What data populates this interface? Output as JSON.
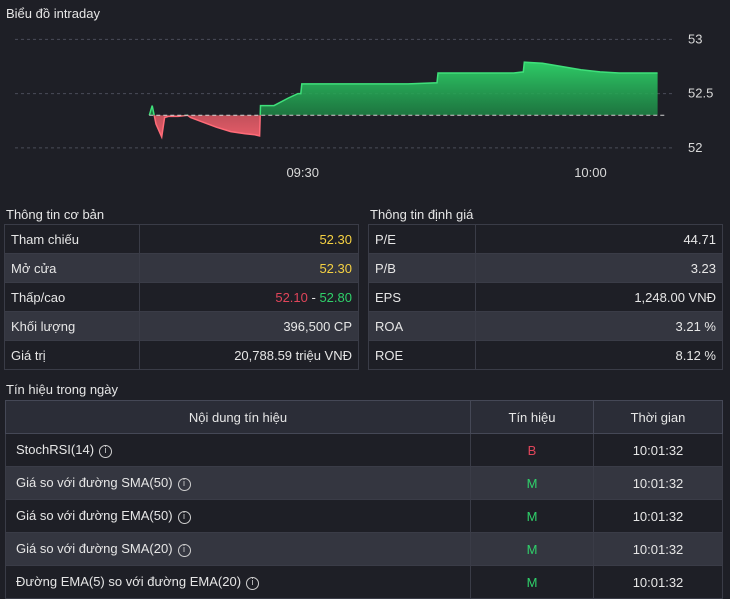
{
  "chart": {
    "title": "Biểu đồ intraday",
    "y_ticks": [
      "53",
      "52.5",
      "52"
    ],
    "x_ticks": [
      "09:30",
      "10:00"
    ]
  },
  "chart_data": {
    "type": "area",
    "reference": 52.3,
    "ylim": [
      51.98,
      53.05
    ],
    "x_ticks": [
      {
        "label": "09:30",
        "x": 30
      },
      {
        "label": "10:00",
        "x": 60
      }
    ],
    "points": [
      [
        14.0,
        52.3
      ],
      [
        14.3,
        52.39
      ],
      [
        14.7,
        52.22
      ],
      [
        15.3,
        52.1
      ],
      [
        15.6,
        52.28
      ],
      [
        16.0,
        52.29
      ],
      [
        17.0,
        52.29
      ],
      [
        18.0,
        52.3
      ],
      [
        18.3,
        52.28
      ],
      [
        19.5,
        52.24
      ],
      [
        21.0,
        52.19
      ],
      [
        22.5,
        52.15
      ],
      [
        24.0,
        52.13
      ],
      [
        25.0,
        52.12
      ],
      [
        25.5,
        52.11
      ],
      [
        25.6,
        52.39
      ],
      [
        27.0,
        52.39
      ],
      [
        28.5,
        52.46
      ],
      [
        29.5,
        52.5
      ],
      [
        29.8,
        52.5
      ],
      [
        29.9,
        52.59
      ],
      [
        32.0,
        52.59
      ],
      [
        35.0,
        52.59
      ],
      [
        38.0,
        52.59
      ],
      [
        41.0,
        52.59
      ],
      [
        44.0,
        52.6
      ],
      [
        44.1,
        52.69
      ],
      [
        48.0,
        52.69
      ],
      [
        52.0,
        52.69
      ],
      [
        53.0,
        52.7
      ],
      [
        53.1,
        52.79
      ],
      [
        55.0,
        52.78
      ],
      [
        57.0,
        52.75
      ],
      [
        59.0,
        52.72
      ],
      [
        61.0,
        52.7
      ],
      [
        63.0,
        52.69
      ],
      [
        65.0,
        52.69
      ],
      [
        67.0,
        52.69
      ]
    ],
    "colors": {
      "up": "#22c55e",
      "down": "#ef4444",
      "reference": "#cfcfcf"
    }
  },
  "basic_info": {
    "title": "Thông tin cơ bản",
    "rows": [
      {
        "label": "Tham chiếu",
        "value": "52.30"
      },
      {
        "label": "Mở cửa",
        "value": "52.30"
      },
      {
        "label": "Thấp/cao",
        "low": "52.10",
        "sep": " - ",
        "high": "52.80"
      },
      {
        "label": "Khối lượng",
        "value": "396,500 CP"
      },
      {
        "label": "Giá trị",
        "value": "20,788.59 triệu VNĐ"
      }
    ]
  },
  "valuation": {
    "title": "Thông tin định giá",
    "rows": [
      {
        "label": "P/E",
        "value": "44.71"
      },
      {
        "label": "P/B",
        "value": "3.23"
      },
      {
        "label": "EPS",
        "value": "1,248.00 VNĐ"
      },
      {
        "label": "ROA",
        "value": "3.21 %"
      },
      {
        "label": "ROE",
        "value": "8.12 %"
      }
    ]
  },
  "signals": {
    "title": "Tín hiệu trong ngày",
    "headers": [
      "Nội dung tín hiệu",
      "Tín hiệu",
      "Thời gian"
    ],
    "info_glyph": "i",
    "rows": [
      {
        "name": "StochRSI(14)",
        "signal": "B",
        "time": "10:01:32"
      },
      {
        "name": "Giá so với đường SMA(50)",
        "signal": "M",
        "time": "10:01:32"
      },
      {
        "name": "Giá so với đường EMA(50)",
        "signal": "M",
        "time": "10:01:32"
      },
      {
        "name": "Giá so với đường SMA(20)",
        "signal": "M",
        "time": "10:01:32"
      },
      {
        "name": "Đường EMA(5) so với đường EMA(20)",
        "signal": "M",
        "time": "10:01:32"
      }
    ]
  }
}
